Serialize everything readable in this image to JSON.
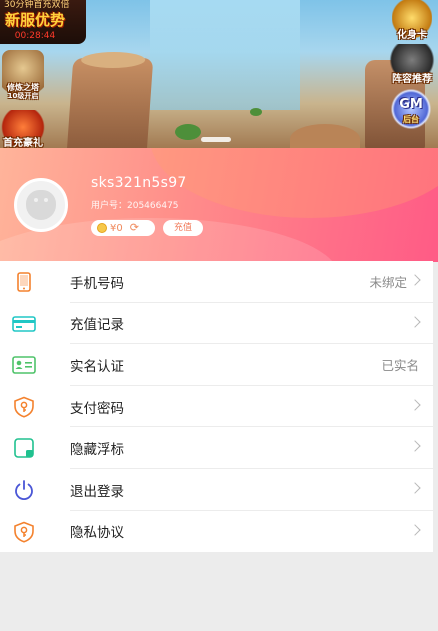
{
  "banner": {
    "promo_top": "30分钟首充双倍",
    "promo_title": "新服优势",
    "promo_timer": "00:28:44",
    "tower_label": "修炼之塔",
    "tower_sub": "10级开启",
    "gift_label": "首充豪礼",
    "avatar_label": "化身卡",
    "star_label": "阵容推荐",
    "gm_label": "GM",
    "gm_sub": "后台"
  },
  "profile": {
    "username": "sks321n5s97",
    "user_id_text": "用户号：205466475",
    "balance": "¥0",
    "recharge_label": "充值"
  },
  "menu": {
    "items": [
      {
        "label": "手机号码",
        "value": "未绑定",
        "icon": "phone-icon",
        "color": "#f4822e"
      },
      {
        "label": "充值记录",
        "value": "",
        "icon": "card-icon",
        "color": "#20c7c5"
      },
      {
        "label": "实名认证",
        "value": "已实名",
        "icon": "id-card-icon",
        "color": "#4fc36a"
      },
      {
        "label": "支付密码",
        "value": "",
        "icon": "shield-key-icon",
        "color": "#f4822e"
      },
      {
        "label": "隐藏浮标",
        "value": "",
        "icon": "float-hide-icon",
        "color": "#20c18f"
      },
      {
        "label": "退出登录",
        "value": "",
        "icon": "power-icon",
        "color": "#4a56d6"
      },
      {
        "label": "隐私协议",
        "value": "",
        "icon": "privacy-shield-icon",
        "color": "#f4822e"
      }
    ]
  },
  "colors": {
    "profile_gradient_start": "#ffb49a",
    "profile_gradient_end": "#ff5b86",
    "accent": "#f07a5a"
  }
}
